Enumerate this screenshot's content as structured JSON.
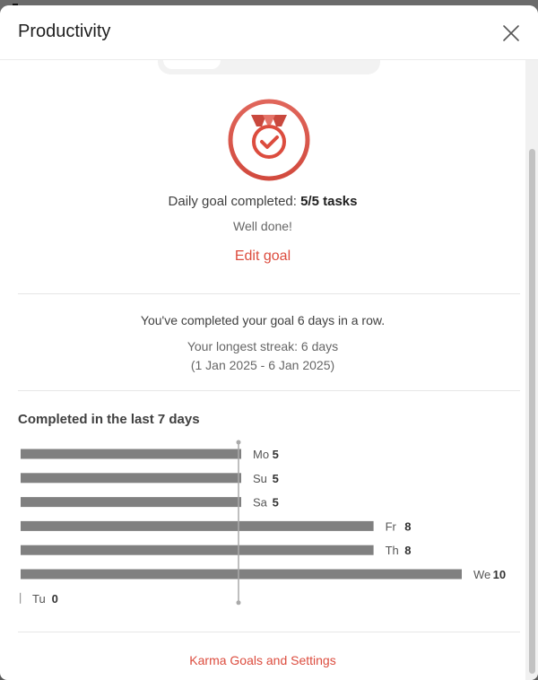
{
  "modal": {
    "title": "Productivity",
    "close_icon": "close-icon"
  },
  "goal": {
    "medal_icon": "medal-check-icon",
    "completed_prefix": "Daily goal completed: ",
    "completed_value": "5/5 tasks",
    "message": "Well done!",
    "edit_label": "Edit goal"
  },
  "streak": {
    "summary": "You've completed your goal 6 days in a row.",
    "longest": "Your longest streak: 6 days",
    "range": "(1 Jan 2025 - 6 Jan 2025)"
  },
  "weekly": {
    "title": "Completed in the last 7 days"
  },
  "chart_data": {
    "type": "bar",
    "orientation": "horizontal",
    "categories": [
      "Mo",
      "Su",
      "Sa",
      "Fr",
      "Th",
      "We",
      "Tu"
    ],
    "values": [
      5,
      5,
      5,
      8,
      8,
      10,
      0
    ],
    "goal_line": 5,
    "xlim": [
      0,
      10
    ]
  },
  "footer": {
    "link_label": "Karma Goals and Settings"
  },
  "colors": {
    "accent": "#dc4c3e",
    "bar": "#808080",
    "goal_line": "#aaaaaa"
  }
}
